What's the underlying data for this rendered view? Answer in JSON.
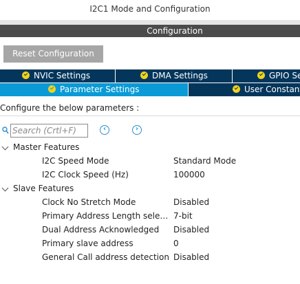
{
  "window": {
    "title": "I2C1 Mode and Configuration"
  },
  "config_header": {
    "label": "Configuration"
  },
  "toolbar": {
    "reset_label": "Reset Configuration"
  },
  "tabs_row1": [
    {
      "label": "NVIC Settings"
    },
    {
      "label": "DMA Settings"
    },
    {
      "label": "GPIO Settings"
    }
  ],
  "tabs_row2": [
    {
      "label": "Parameter Settings",
      "active": true
    },
    {
      "label": "User Constants"
    }
  ],
  "configure_text": "Configure the below parameters :",
  "search": {
    "placeholder": "Search (Crtl+F)"
  },
  "groups": [
    {
      "label": "Master Features",
      "params": [
        {
          "name": "I2C Speed Mode",
          "value": "Standard Mode"
        },
        {
          "name": "I2C Clock Speed (Hz)",
          "value": "100000"
        }
      ]
    },
    {
      "label": "Slave Features",
      "params": [
        {
          "name": "Clock No Stretch Mode",
          "value": "Disabled"
        },
        {
          "name": "Primary Address Length selec...",
          "value": "7-bit"
        },
        {
          "name": "Dual Address Acknowledged",
          "value": "Disabled"
        },
        {
          "name": "Primary slave address",
          "value": "0"
        },
        {
          "name": "General Call address detection",
          "value": "Disabled"
        }
      ]
    }
  ],
  "colors": {
    "tab_bg": "#04365c",
    "tab_active": "#0a9bd6",
    "check_icon": "#f2d21b",
    "config_bar": "#4b4b4b",
    "reset_button": "#a6a6a6",
    "nav_arrow": "#2a8fd0"
  },
  "icons": {
    "search": "search-icon",
    "prev": "arrow-left-circle-icon",
    "next": "arrow-right-circle-icon",
    "check": "check-circle-icon",
    "expand": "chevron-down-icon"
  }
}
